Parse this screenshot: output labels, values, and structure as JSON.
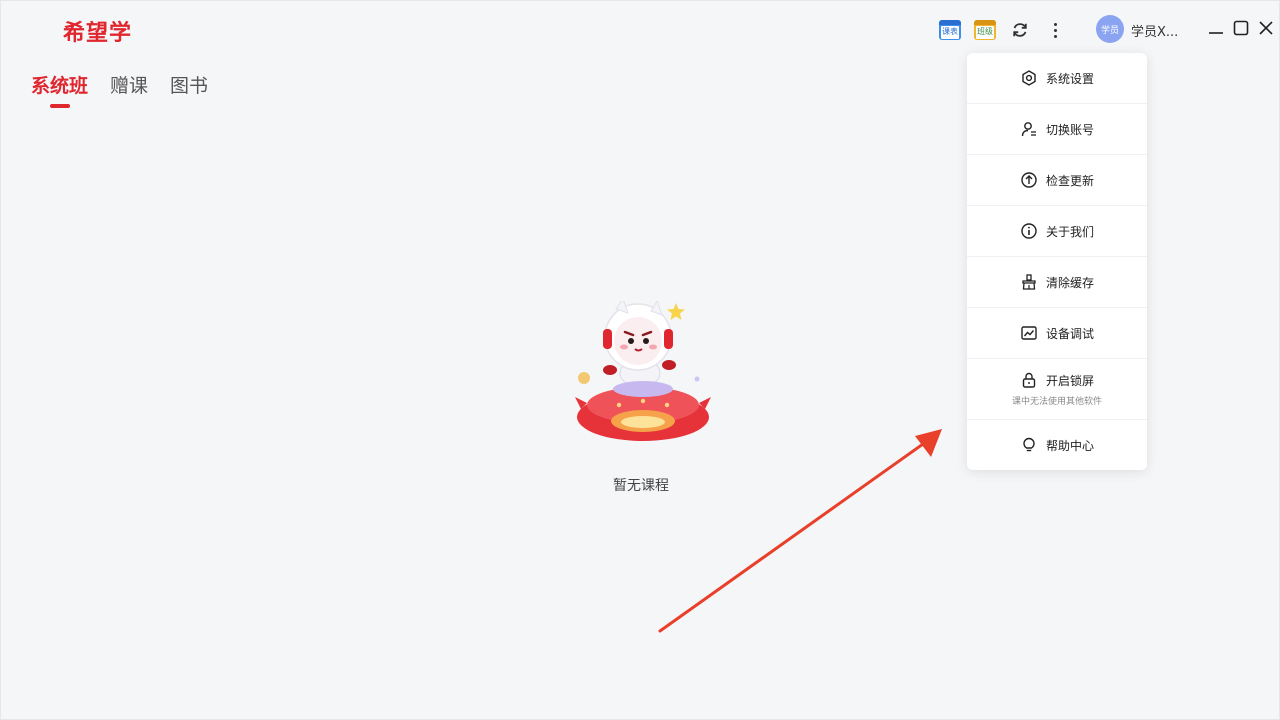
{
  "app": {
    "logo": "希望学"
  },
  "tabs": [
    {
      "label": "系统班",
      "active": true
    },
    {
      "label": "赠课",
      "active": false
    },
    {
      "label": "图书",
      "active": false
    }
  ],
  "toolbar": {
    "schedule_label": "课表",
    "class_label": "班级"
  },
  "user": {
    "avatar_text": "学员",
    "name": "学员X..."
  },
  "menu": {
    "items": [
      {
        "label": "系统设置",
        "icon": "settings-icon"
      },
      {
        "label": "切换账号",
        "icon": "switch-account-icon"
      },
      {
        "label": "检查更新",
        "icon": "upload-arrow-icon"
      },
      {
        "label": "关于我们",
        "icon": "info-icon"
      },
      {
        "label": "清除缓存",
        "icon": "broom-icon"
      },
      {
        "label": "设备调试",
        "icon": "chart-icon"
      },
      {
        "label": "开启锁屏",
        "icon": "lock-icon",
        "sub": "课中无法使用其他软件"
      },
      {
        "label": "帮助中心",
        "icon": "lightbulb-icon"
      }
    ]
  },
  "empty": {
    "text": "暂无课程"
  },
  "colors": {
    "brand_red": "#e0262e",
    "annotation_arrow": "#e8402a",
    "background": "#f5f6f8"
  }
}
